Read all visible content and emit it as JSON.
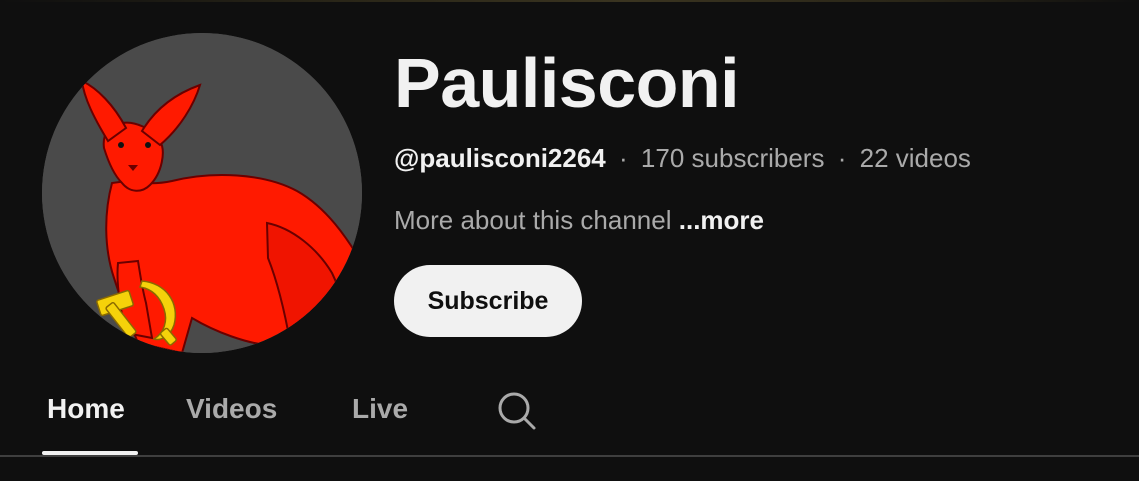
{
  "channel": {
    "name": "Paulisconi",
    "handle": "@paulisconi2264",
    "separator": "·",
    "subscribers": "170 subscribers",
    "videos": "22 videos",
    "about": "More about this channel",
    "more_label": "...more",
    "subscribe_label": "Subscribe",
    "avatar_icon": "red-fennec-hammer-sickle-avatar"
  },
  "tabs": [
    {
      "label": "Home",
      "active": true
    },
    {
      "label": "Videos",
      "active": false
    },
    {
      "label": "Live",
      "active": false
    }
  ],
  "icons": {
    "search": "search-icon"
  },
  "colors": {
    "background": "#0f0f0f",
    "text_primary": "#f1f1f1",
    "text_secondary": "#aaaaaa",
    "subscribe_bg": "#f1f1f1",
    "avatar_bg": "#4a4a4a",
    "avatar_figure": "#ff0000",
    "avatar_emblem": "#f5d20a"
  }
}
